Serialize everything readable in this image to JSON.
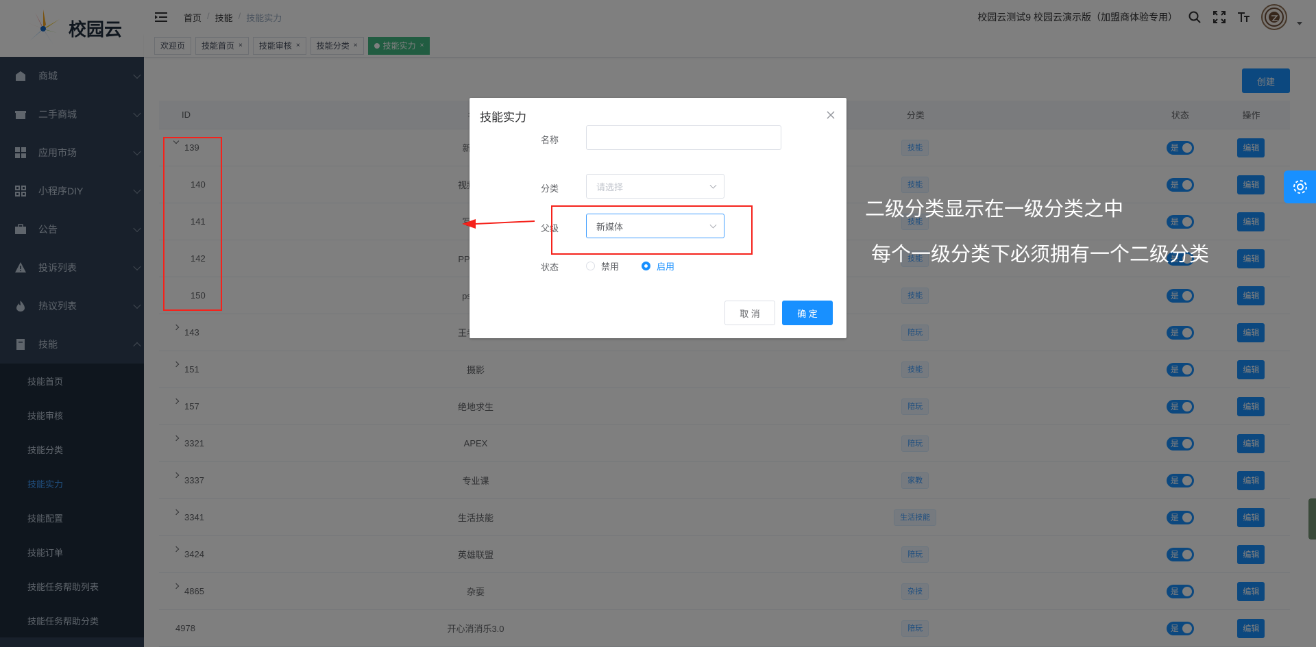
{
  "app": {
    "logo_text": "校园云"
  },
  "sidebar": {
    "items": [
      {
        "label": "商城",
        "icon": "shop-icon"
      },
      {
        "label": "二手商城",
        "icon": "gift-icon"
      },
      {
        "label": "应用市场",
        "icon": "apps-icon"
      },
      {
        "label": "小程序DIY",
        "icon": "grid-icon"
      },
      {
        "label": "公告",
        "icon": "briefcase-icon"
      },
      {
        "label": "投诉列表",
        "icon": "warning-icon"
      },
      {
        "label": "热议列表",
        "icon": "fire-icon"
      },
      {
        "label": "技能",
        "icon": "book-icon"
      }
    ],
    "sub_items": [
      "技能首页",
      "技能审核",
      "技能分类",
      "技能实力",
      "技能配置",
      "技能订单",
      "技能任务帮助列表",
      "技能任务帮助分类"
    ]
  },
  "header": {
    "breadcrumb": [
      "首页",
      "技能",
      "技能实力"
    ],
    "breadcrumb_sep": "/",
    "site_name": "校园云测试9 校园云演示版（加盟商体验专用）"
  },
  "tags": [
    {
      "label": "欢迎页",
      "closable": false
    },
    {
      "label": "技能首页",
      "closable": true
    },
    {
      "label": "技能审核",
      "closable": true
    },
    {
      "label": "技能分类",
      "closable": true
    },
    {
      "label": "技能实力",
      "closable": true
    }
  ],
  "tag_close": "×",
  "main": {
    "create_label": "创建"
  },
  "table": {
    "headers": {
      "id": "ID",
      "name": "名称",
      "category": "分类",
      "status": "状态",
      "op": "操作"
    },
    "status_on": "是",
    "edit_label": "编辑",
    "rows": [
      {
        "id": "139",
        "name": "新媒体",
        "category": "技能"
      },
      {
        "id": "140",
        "name": "视频制作",
        "category": "技能"
      },
      {
        "id": "141",
        "name": "写文章",
        "category": "技能"
      },
      {
        "id": "142",
        "name": "PPT制作",
        "category": "技能"
      },
      {
        "id": "150",
        "name": "ps修图",
        "category": "技能"
      },
      {
        "id": "143",
        "name": "王者荣耀",
        "category": "陪玩"
      },
      {
        "id": "151",
        "name": "摄影",
        "category": "技能"
      },
      {
        "id": "157",
        "name": "绝地求生",
        "category": "陪玩"
      },
      {
        "id": "3321",
        "name": "APEX",
        "category": "陪玩"
      },
      {
        "id": "3337",
        "name": "专业课",
        "category": "家教"
      },
      {
        "id": "3341",
        "name": "生活技能",
        "category": "生活技能"
      },
      {
        "id": "3424",
        "name": "英雄联盟",
        "category": "陪玩"
      },
      {
        "id": "4865",
        "name": "杂耍",
        "category": "杂技"
      },
      {
        "id": "4978",
        "name": "开心消消乐3.0",
        "category": "陪玩"
      }
    ]
  },
  "dialog": {
    "title": "技能实力",
    "name_label": "名称",
    "name_value": "",
    "category_label": "分类",
    "category_placeholder": "请选择",
    "parent_label": "父级",
    "parent_value": "新媒体",
    "status_label": "状态",
    "status_disabled": "禁用",
    "status_enabled": "启用",
    "status_selected": "启用",
    "cancel_label": "取 消",
    "ok_label": "确 定"
  },
  "annotations": {
    "note1": "二级分类显示在一级分类之中",
    "note2": "每个一级分类下必须拥有一个二级分类"
  },
  "colors": {
    "primary": "#1890ff",
    "sidebar_bg": "#304156",
    "active_tag": "#42b983",
    "annotation_red": "#f5221b"
  }
}
